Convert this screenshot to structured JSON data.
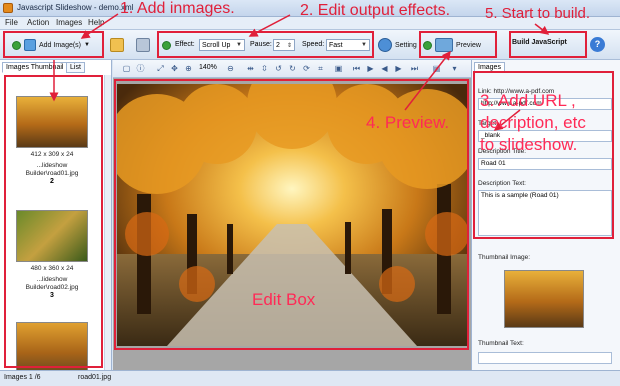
{
  "window": {
    "title": "Javascript Slideshow - demo.xml"
  },
  "menu": {
    "items": [
      "File",
      "Action",
      "Images",
      "Help"
    ]
  },
  "toolbar": {
    "add_images": "Add Image(s)",
    "effect_label": "Effect:",
    "effect_value": "Scroll Up",
    "pause_label": "Pause:",
    "pause_value": "2",
    "speed_label": "Speed:",
    "speed_value": "Fast",
    "setting": "Setting",
    "preview": "Preview",
    "build": "Build JavaScript"
  },
  "left_tabs": {
    "thumbnail": "Images Thumbnail",
    "list": "List"
  },
  "thumbnails": [
    {
      "size": "412 x 309 x 24",
      "file": "...lideshow Builder\\road01.jpg",
      "number": "2"
    },
    {
      "size": "480 x 360 x 24",
      "file": "...lideshow Builder\\road02.jpg",
      "number": "3"
    }
  ],
  "image_toolbar": {
    "zoom": "140%"
  },
  "right_panel": {
    "tab": "Images",
    "link_label": "Link: http://www.a-pdf.com",
    "link_value": "http://www.a-pdf.com",
    "target_label": "Target:",
    "target_value": "_blank",
    "desc_title_label": "Description Title:",
    "desc_title_value": "Road 01",
    "desc_text_label": "Description Text:",
    "desc_text_value": "This is a sample (Road 01)",
    "thumb_image_label": "Thumbnail Image:",
    "thumb_text_label": "Thumbnail Text:"
  },
  "status": {
    "count": "Images 1 /6",
    "file": "road01.jpg"
  },
  "annotations": {
    "a1": "1. Add inmages.",
    "a2": "2. Edit output effects.",
    "a5": "5. Start to build.",
    "a3_line1": "3. Add URL ,",
    "a3_line2": "decription, etc",
    "a3_line3": "to slideshow.",
    "a4": "4. Preview.",
    "edit_box": "Edit Box"
  },
  "colors": {
    "annotation": "#e0203a",
    "panel_bg": "#d8e4f2",
    "toolbar_bg": "#e6eef8"
  }
}
